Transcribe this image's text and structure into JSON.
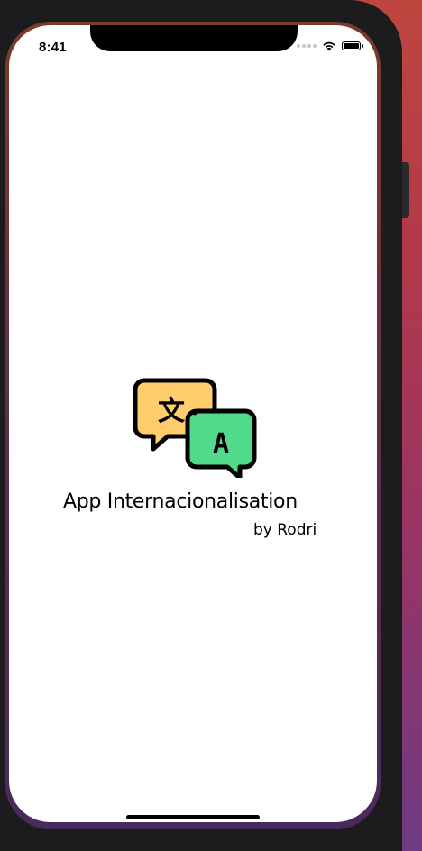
{
  "status_bar": {
    "time": "8:41",
    "icons": [
      "cellular-dots-icon",
      "wifi-icon",
      "battery-icon"
    ],
    "battery_level": 1.0
  },
  "splash": {
    "logo_icon": "translate-chat-bubbles-icon",
    "logo_glyph_left": "文",
    "logo_glyph_right": "A",
    "title": "App Internacionalisation",
    "subtitle": "by Rodri"
  },
  "colors": {
    "bubble_left": "#ffcd6b",
    "bubble_right": "#4fdb8a",
    "outline": "#000000",
    "screen_background": "#ffffff",
    "frame": "#1c1c1e"
  }
}
